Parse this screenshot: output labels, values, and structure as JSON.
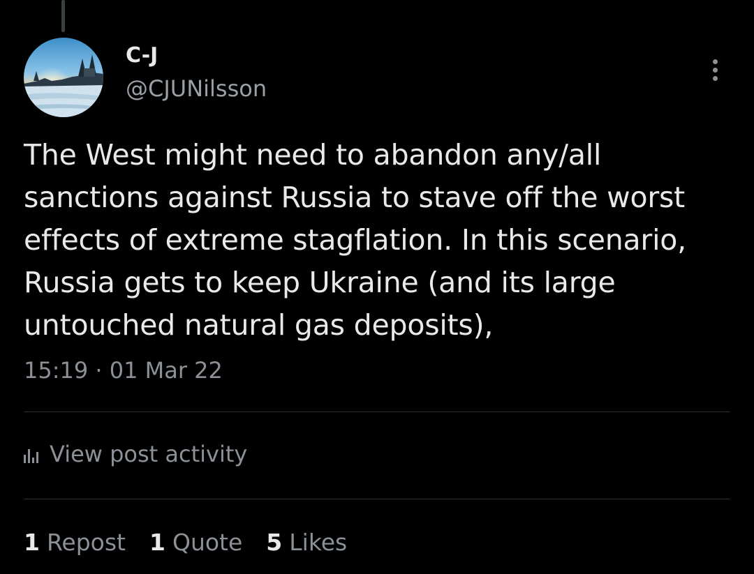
{
  "author": {
    "display_name": "C-J",
    "handle": "@CJUNilsson",
    "avatar_icon": "winter-landscape-avatar"
  },
  "tweet": {
    "text": "The West might need to abandon any/all\nsanctions against Russia to stave off the worst\neffects of extreme stagflation. In this scenario,\nRussia gets to keep Ukraine (and its large\nuntouched natural gas deposits),",
    "timestamp": "15:19 · 01 Mar 22"
  },
  "activity": {
    "label": "View post activity",
    "icon": "bar-chart-icon"
  },
  "stats": [
    {
      "count": "1",
      "label": "Repost"
    },
    {
      "count": "1",
      "label": "Quote"
    },
    {
      "count": "5",
      "label": "Likes"
    }
  ],
  "colors": {
    "background": "#000000",
    "primary_text": "#e7e9ea",
    "secondary_text": "#8b9196",
    "divider": "#2f3336"
  }
}
